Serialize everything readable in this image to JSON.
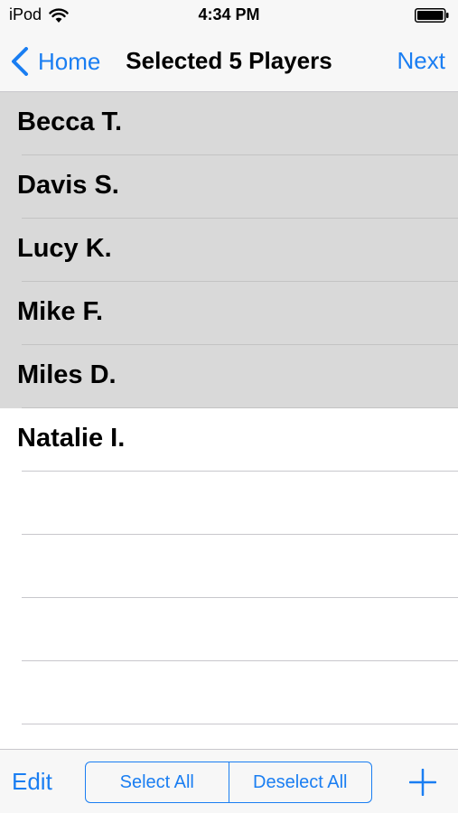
{
  "status_bar": {
    "carrier": "iPod",
    "time": "4:34 PM",
    "wifi_icon": "wifi-icon",
    "battery_icon": "battery-full-icon"
  },
  "nav_bar": {
    "back_label": "Home",
    "title": "Selected 5 Players",
    "next_label": "Next",
    "accent_color": "#1a7ef2"
  },
  "players": [
    {
      "name": "Becca T.",
      "selected": true
    },
    {
      "name": "Davis S.",
      "selected": true
    },
    {
      "name": "Lucy K.",
      "selected": true
    },
    {
      "name": "Mike F.",
      "selected": true
    },
    {
      "name": "Miles D.",
      "selected": true
    },
    {
      "name": "Natalie I.",
      "selected": false
    }
  ],
  "toolbar": {
    "edit_label": "Edit",
    "select_all_label": "Select All",
    "deselect_all_label": "Deselect All",
    "add_icon": "plus-icon"
  },
  "colors": {
    "selected_row": "#d9d9d9",
    "separator": "#c8c7cc",
    "bar_background": "#f7f7f7"
  }
}
